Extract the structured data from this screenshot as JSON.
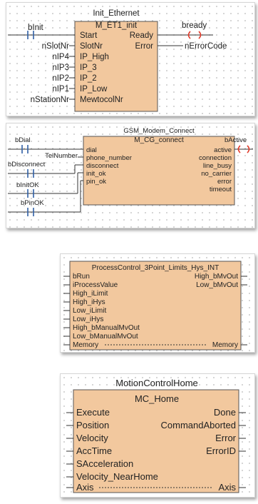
{
  "colors": {
    "block_fill": "#f2c89e",
    "contact": "#2f5fa5",
    "coil": "#e23b2b",
    "border": "#555555"
  },
  "diagram1": {
    "instance": "Init_Ethernet",
    "type": "M_ET1_init",
    "inputs": [
      "Start",
      "SlotNr",
      "IP_High",
      "IP_3",
      "IP_2",
      "IP_Low",
      "MewtocolNr"
    ],
    "outputs": [
      "Ready",
      "Error"
    ],
    "in_vars": [
      "bInit",
      "nSlotNr",
      "nIP4",
      "nIP3",
      "nIP2",
      "nIP1",
      "nStationNr"
    ],
    "out_vars": [
      "bready",
      "nErrorCode"
    ]
  },
  "diagram2": {
    "instance": "GSM_Modem_Connect",
    "type": "M_CG_connect",
    "inputs": [
      "dial",
      "phone_number",
      "disconnect",
      "init_ok",
      "pin_ok"
    ],
    "outputs": [
      "active",
      "connection",
      "line_busy",
      "no_carrier",
      "error",
      "timeout"
    ],
    "in_vars": [
      "bDial",
      "TelNumber",
      "bDisconnect",
      "bInitOK",
      "bPinOK"
    ],
    "out_vars": [
      "bActive"
    ]
  },
  "diagram3": {
    "type": "ProcessControl_3Point_Limits_Hys_INT",
    "inputs": [
      "bRun",
      "iProcessValue",
      "High_iLimit",
      "High_iHys",
      "Low_iLimit",
      "Low_iHys",
      "High_bManualMvOut",
      "Low_bManualMvOut",
      "Memory"
    ],
    "outputs": [
      "High_bMvOut",
      "Low_bMvOut",
      "Memory"
    ]
  },
  "diagram4": {
    "instance": "MotionControlHome",
    "type": "MC_Home",
    "inputs": [
      "Execute",
      "Position",
      "Velocity",
      "AccTime",
      "SAcceleration",
      "Velocity_NearHome",
      "Axis"
    ],
    "outputs": [
      "Done",
      "CommandAborted",
      "Error",
      "ErrorID",
      "Axis"
    ]
  }
}
